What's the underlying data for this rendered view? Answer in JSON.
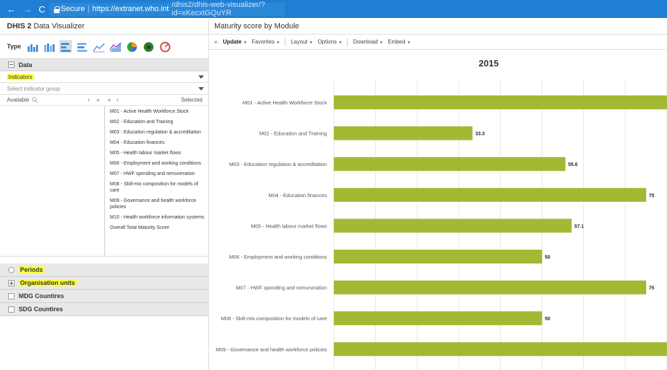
{
  "browser": {
    "back": "←",
    "forward": "→",
    "reload": "C",
    "secure": "Secure",
    "url_host": "https://extranet.who.int",
    "url_path": "/dhis2/dhis-web-visualizer/?id=xKecxtGQuYR"
  },
  "left": {
    "app_title_brand": "DHIS 2",
    "app_title_rest": " Data Visualizer",
    "type_label": "Type",
    "data_section": "Data",
    "indicators_dropdown": "Indicators",
    "indicator_group_placeholder": "Select indicator group",
    "available_label": "Available",
    "selected_label": "Selected",
    "selected_items": [
      "M01 - Active Health Workforce Stock",
      "M02 - Education and Training",
      "M03 - Education regulation & accreditation",
      "M04 - Education finances",
      "M05 - Health labour market flows",
      "M06 - Employment and working conditions",
      "M07 - HWF spending and remuneration",
      "M08 - Skill-mix composition for models of care",
      "M09 - Governance and health workforce policies",
      "M10 - Health workforce information systems",
      "Overall Total Maturity Score"
    ],
    "periods": "Periods",
    "org_units": "Organisation units",
    "mdg": "MDG Countires",
    "sdg": "SDG Countires"
  },
  "right": {
    "title": "Maturity score by Module",
    "toolbar": {
      "collapse": "«",
      "update": "Update",
      "favorites": "Favorites",
      "layout": "Layout",
      "options": "Options",
      "download": "Download",
      "embed": "Embed"
    }
  },
  "chart_data": {
    "type": "bar",
    "orientation": "horizontal",
    "title": "2015",
    "categories": [
      "M01 - Active Health Workforce Stock",
      "M02 - Education and Training",
      "M03 - Education regulation & accreditation",
      "M04 - Education finances",
      "M05 - Health labour market flows",
      "M06 - Employment and working conditions",
      "M07 - HWF spending and remuneration",
      "M08 - Skill-mix composition for models of care",
      "M09 - Governance and health workforce policies"
    ],
    "values": [
      100,
      33.3,
      55.6,
      75,
      57.1,
      50,
      75,
      50,
      100
    ],
    "data_labels": [
      "",
      "33.3",
      "55.6",
      "75",
      "57.1",
      "50",
      "75",
      "50",
      ""
    ],
    "xlim": [
      0,
      80
    ],
    "grid": true,
    "bar_color": "#a2b933"
  }
}
